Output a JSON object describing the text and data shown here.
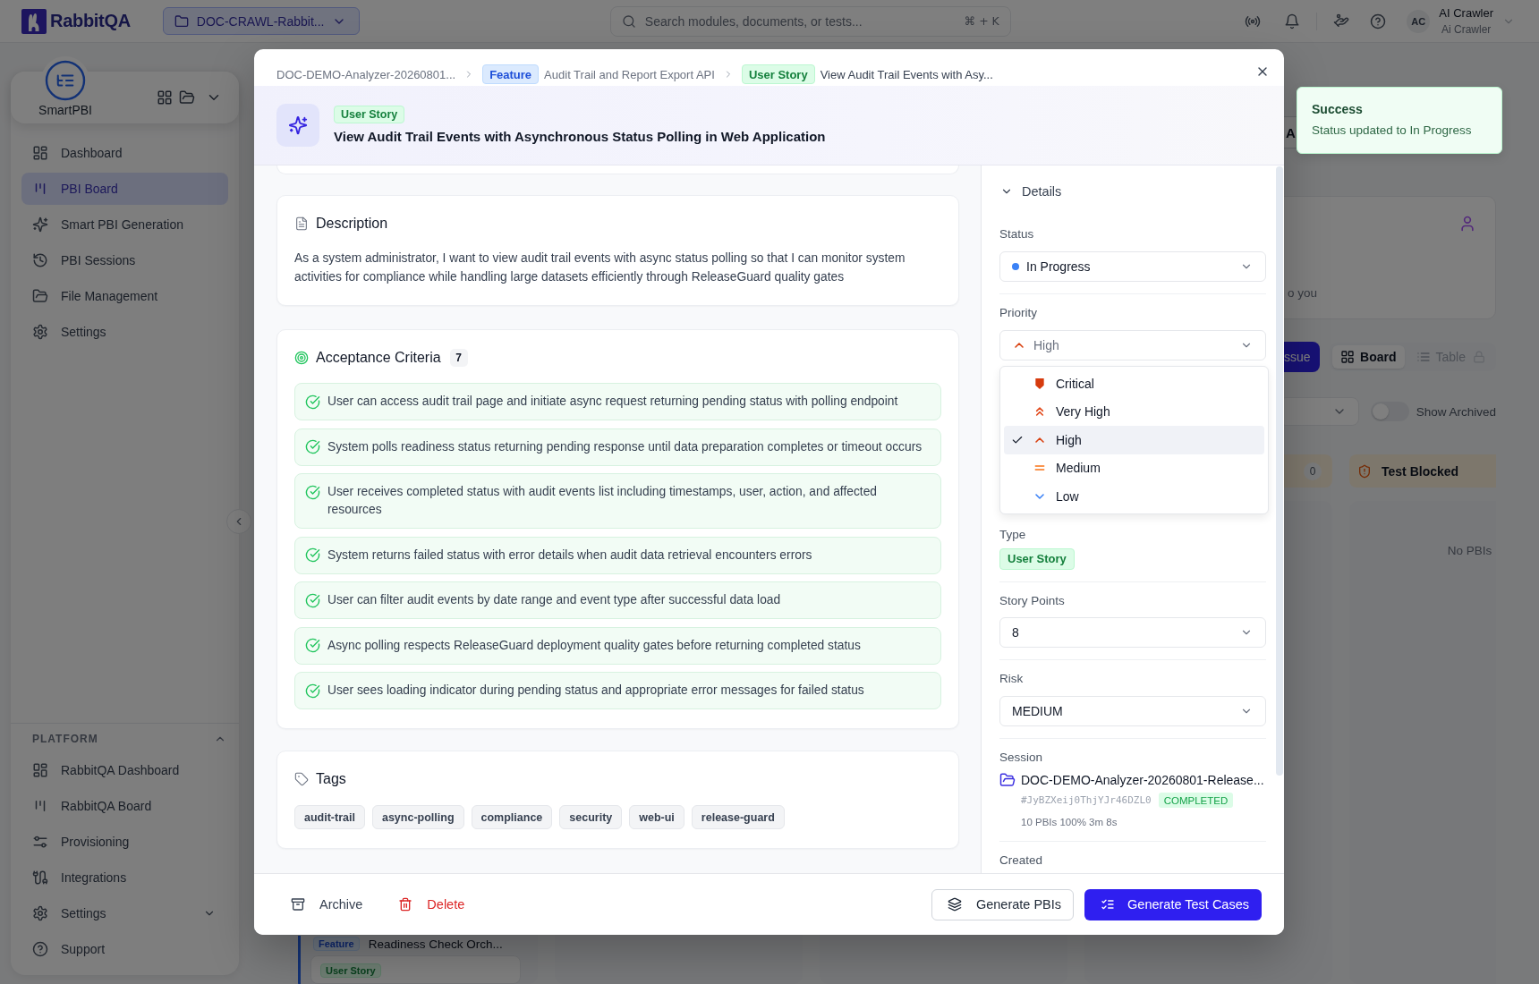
{
  "topbar": {
    "logo": "RabbitQA",
    "project": "DOC-CRAWL-Rabbit...",
    "search": {
      "placeholder": "Search modules, documents, or tests...",
      "shortcut": "⌘ + K"
    },
    "user": {
      "initials": "AC",
      "name": "AI Crawler",
      "role": "Ai Crawler"
    }
  },
  "sidebar": {
    "app": "SmartPBI",
    "items": [
      {
        "label": "Dashboard",
        "selected": false
      },
      {
        "label": "PBI Board",
        "selected": true
      },
      {
        "label": "Smart PBI Generation",
        "selected": false
      },
      {
        "label": "PBI Sessions",
        "selected": false
      },
      {
        "label": "File Management",
        "selected": false
      },
      {
        "label": "Settings",
        "selected": false
      }
    ],
    "platform": {
      "title": "PLATFORM",
      "expanded": true,
      "items": [
        {
          "label": "RabbitQA Dashboard",
          "kind": "link",
          "selected": false
        },
        {
          "label": "RabbitQA Board",
          "kind": "link",
          "selected": false
        },
        {
          "label": "Provisioning",
          "kind": "link",
          "selected": false
        },
        {
          "label": "Integrations",
          "kind": "link",
          "selected": false
        },
        {
          "label": "Settings",
          "kind": "group",
          "selected": false,
          "expanded": false
        },
        {
          "label": "Support",
          "kind": "link",
          "selected": false
        }
      ]
    }
  },
  "board": {
    "header_button": "A",
    "welcome_text": "o you",
    "primary_button": "ssue",
    "views": [
      {
        "label": "Board",
        "selected": true,
        "locked": false
      },
      {
        "label": "Table",
        "selected": false,
        "locked": true
      }
    ],
    "show_archived": {
      "label": "Show Archived",
      "on": false
    },
    "columns": [
      {
        "group": {
          "badge": {
            "label": "Feature",
            "kind": "feature"
          },
          "title": "Readiness Check Orch...",
          "cards": [
            {
              "badge": {
                "label": "User Story",
                "kind": "user_story"
              }
            }
          ]
        }
      },
      {
        "count": "0"
      },
      {
        "title": "Test Blocked",
        "empty": "No PBIs"
      }
    ]
  },
  "modal": {
    "breadcrumbs": [
      {
        "label": "DOC-DEMO-Analyzer-20260801...",
        "current": false
      },
      {
        "badge": {
          "label": "Feature",
          "kind": "feature"
        },
        "label": "Audit Trail and Report Export API",
        "current": false
      },
      {
        "badge": {
          "label": "User Story",
          "kind": "user_story"
        },
        "label": "View Audit Trail Events with Asy...",
        "current": true
      }
    ],
    "header": {
      "badge": {
        "label": "User Story",
        "kind": "user_story"
      },
      "title": "View Audit Trail Events with Asynchronous Status Polling in Web Application"
    },
    "description": {
      "title": "Description",
      "text": "As a system administrator, I want to view audit trail events with async status polling so that I can monitor system activities for compliance while handling large datasets efficiently through ReleaseGuard quality gates"
    },
    "acceptance_criteria": {
      "title": "Acceptance Criteria",
      "count": "7",
      "items": [
        "User can access audit trail page and initiate async request returning pending status with polling endpoint",
        "System polls readiness status returning pending response until data preparation completes or timeout occurs",
        "User receives completed status with audit events list including timestamps, user, action, and affected resources",
        "System returns failed status with error details when audit data retrieval encounters errors",
        "User can filter audit events by date range and event type after successful data load",
        "Async polling respects ReleaseGuard deployment quality gates before returning completed status",
        "User sees loading indicator during pending status and appropriate error messages for failed status"
      ]
    },
    "tags": {
      "title": "Tags",
      "items": [
        "audit-trail",
        "async-polling",
        "compliance",
        "security",
        "web-ui",
        "release-guard"
      ]
    },
    "details": {
      "title": "Details",
      "expanded": true,
      "status": {
        "label": "Status",
        "value": "In Progress",
        "color": "#3b82f6"
      },
      "priority": {
        "label": "Priority",
        "value": "High",
        "open": true,
        "options": [
          {
            "label": "Critical",
            "selected": false
          },
          {
            "label": "Very High",
            "selected": false
          },
          {
            "label": "High",
            "selected": true
          },
          {
            "label": "Medium",
            "selected": false
          },
          {
            "label": "Low",
            "selected": false
          }
        ]
      },
      "type": {
        "label": "Type",
        "badge": {
          "label": "User Story",
          "kind": "user_story"
        }
      },
      "story_points": {
        "label": "Story Points",
        "value": "8"
      },
      "risk": {
        "label": "Risk",
        "value": "MEDIUM"
      },
      "session": {
        "label": "Session",
        "name": "DOC-DEMO-Analyzer-20260801-Release...",
        "id": "#JyBZXeij0ThjYJr46DZL0",
        "status": "COMPLETED",
        "stats": "10 PBIs 100% 3m 8s"
      },
      "created": {
        "label": "Created"
      }
    },
    "footer": {
      "archive": "Archive",
      "delete": "Delete",
      "generate_pbis": "Generate PBIs",
      "generate_tests": "Generate Test Cases"
    }
  },
  "toast": {
    "title": "Success",
    "message": "Status updated to In Progress"
  }
}
